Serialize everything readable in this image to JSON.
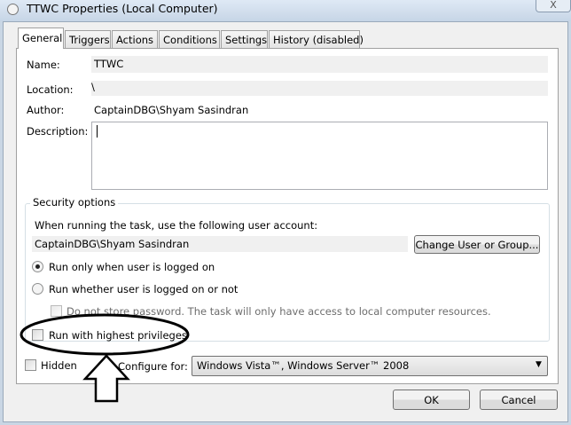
{
  "window": {
    "title": "TTWC Properties (Local Computer)",
    "close": "X"
  },
  "tabs": [
    {
      "label": "General"
    },
    {
      "label": "Triggers"
    },
    {
      "label": "Actions"
    },
    {
      "label": "Conditions"
    },
    {
      "label": "Settings"
    },
    {
      "label": "History (disabled)"
    }
  ],
  "general": {
    "name_label": "Name:",
    "name_value": "TTWC",
    "location_label": "Location:",
    "location_value": "\\",
    "author_label": "Author:",
    "author_value": "CaptainDBG\\Shyam Sasindran",
    "description_label": "Description:",
    "description_value": ""
  },
  "security": {
    "legend": "Security options",
    "account_prompt": "When running the task, use the following user account:",
    "account_value": "CaptainDBG\\Shyam Sasindran",
    "change_button": "Change User or Group...",
    "radio_logged_on": "Run only when user is logged on",
    "radio_whether": "Run whether user is logged on or not",
    "no_store_password": "Do not store password.  The task will only have access to local computer resources.",
    "highest_privileges": "Run with highest privileges",
    "selected_radio": "Run only when user is logged on"
  },
  "hidden_label": "Hidden",
  "configure_label": "Configure for:",
  "configure_value": "Windows Vista™, Windows Server™ 2008",
  "buttons": {
    "ok": "OK",
    "cancel": "Cancel"
  }
}
